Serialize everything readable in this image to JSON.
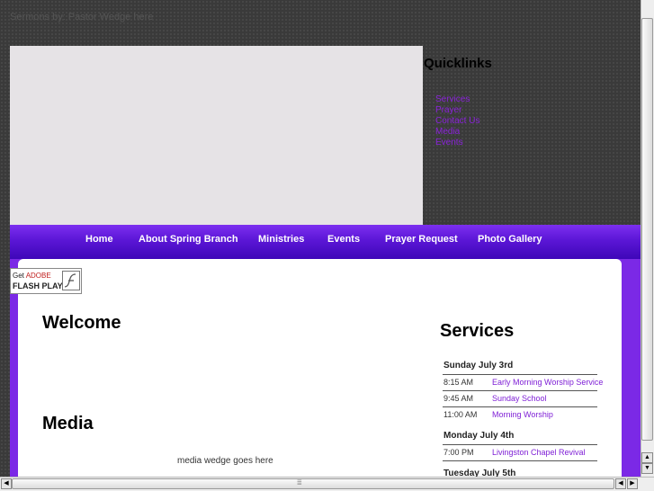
{
  "header": {
    "tagline": "Sermons by: Pastor Wedge here"
  },
  "quicklinks": {
    "title": "Quicklinks",
    "items": [
      "Services",
      "Prayer",
      "Contact Us",
      "Media",
      "Events"
    ]
  },
  "nav": {
    "items": [
      "Home",
      "About Spring Branch",
      "Ministries",
      "Events",
      "Prayer Request",
      "Photo Gallery"
    ]
  },
  "flash_badge": {
    "get": "Get",
    "adobe": "ADOBE",
    "player": "FLASH PLAYER"
  },
  "main": {
    "welcome_title": "Welcome",
    "media_title": "Media",
    "media_placeholder": "media wedge goes here"
  },
  "services": {
    "title": "Services",
    "days": [
      {
        "day": "Sunday July 3rd",
        "events": [
          {
            "time": "8:15 AM",
            "name": "Early Morning Worship Service"
          },
          {
            "time": "9:45 AM",
            "name": "Sunday School"
          },
          {
            "time": "11:00 AM",
            "name": "Morning Worship"
          }
        ]
      },
      {
        "day": "Monday July 4th",
        "events": [
          {
            "time": "7:00 PM",
            "name": "Livingston Chapel Revival"
          }
        ]
      },
      {
        "day": "Tuesday July 5th",
        "events": []
      }
    ]
  },
  "colors": {
    "accent": "#7b29e6",
    "nav_top": "#7c2ff0",
    "nav_bottom": "#3e07b8",
    "link": "#8a23d9"
  },
  "scrollbars": {
    "up_icon": "arrow-up-icon",
    "down_icon": "arrow-down-icon",
    "left_icon": "arrow-left-icon",
    "right_icon": "arrow-right-icon"
  }
}
